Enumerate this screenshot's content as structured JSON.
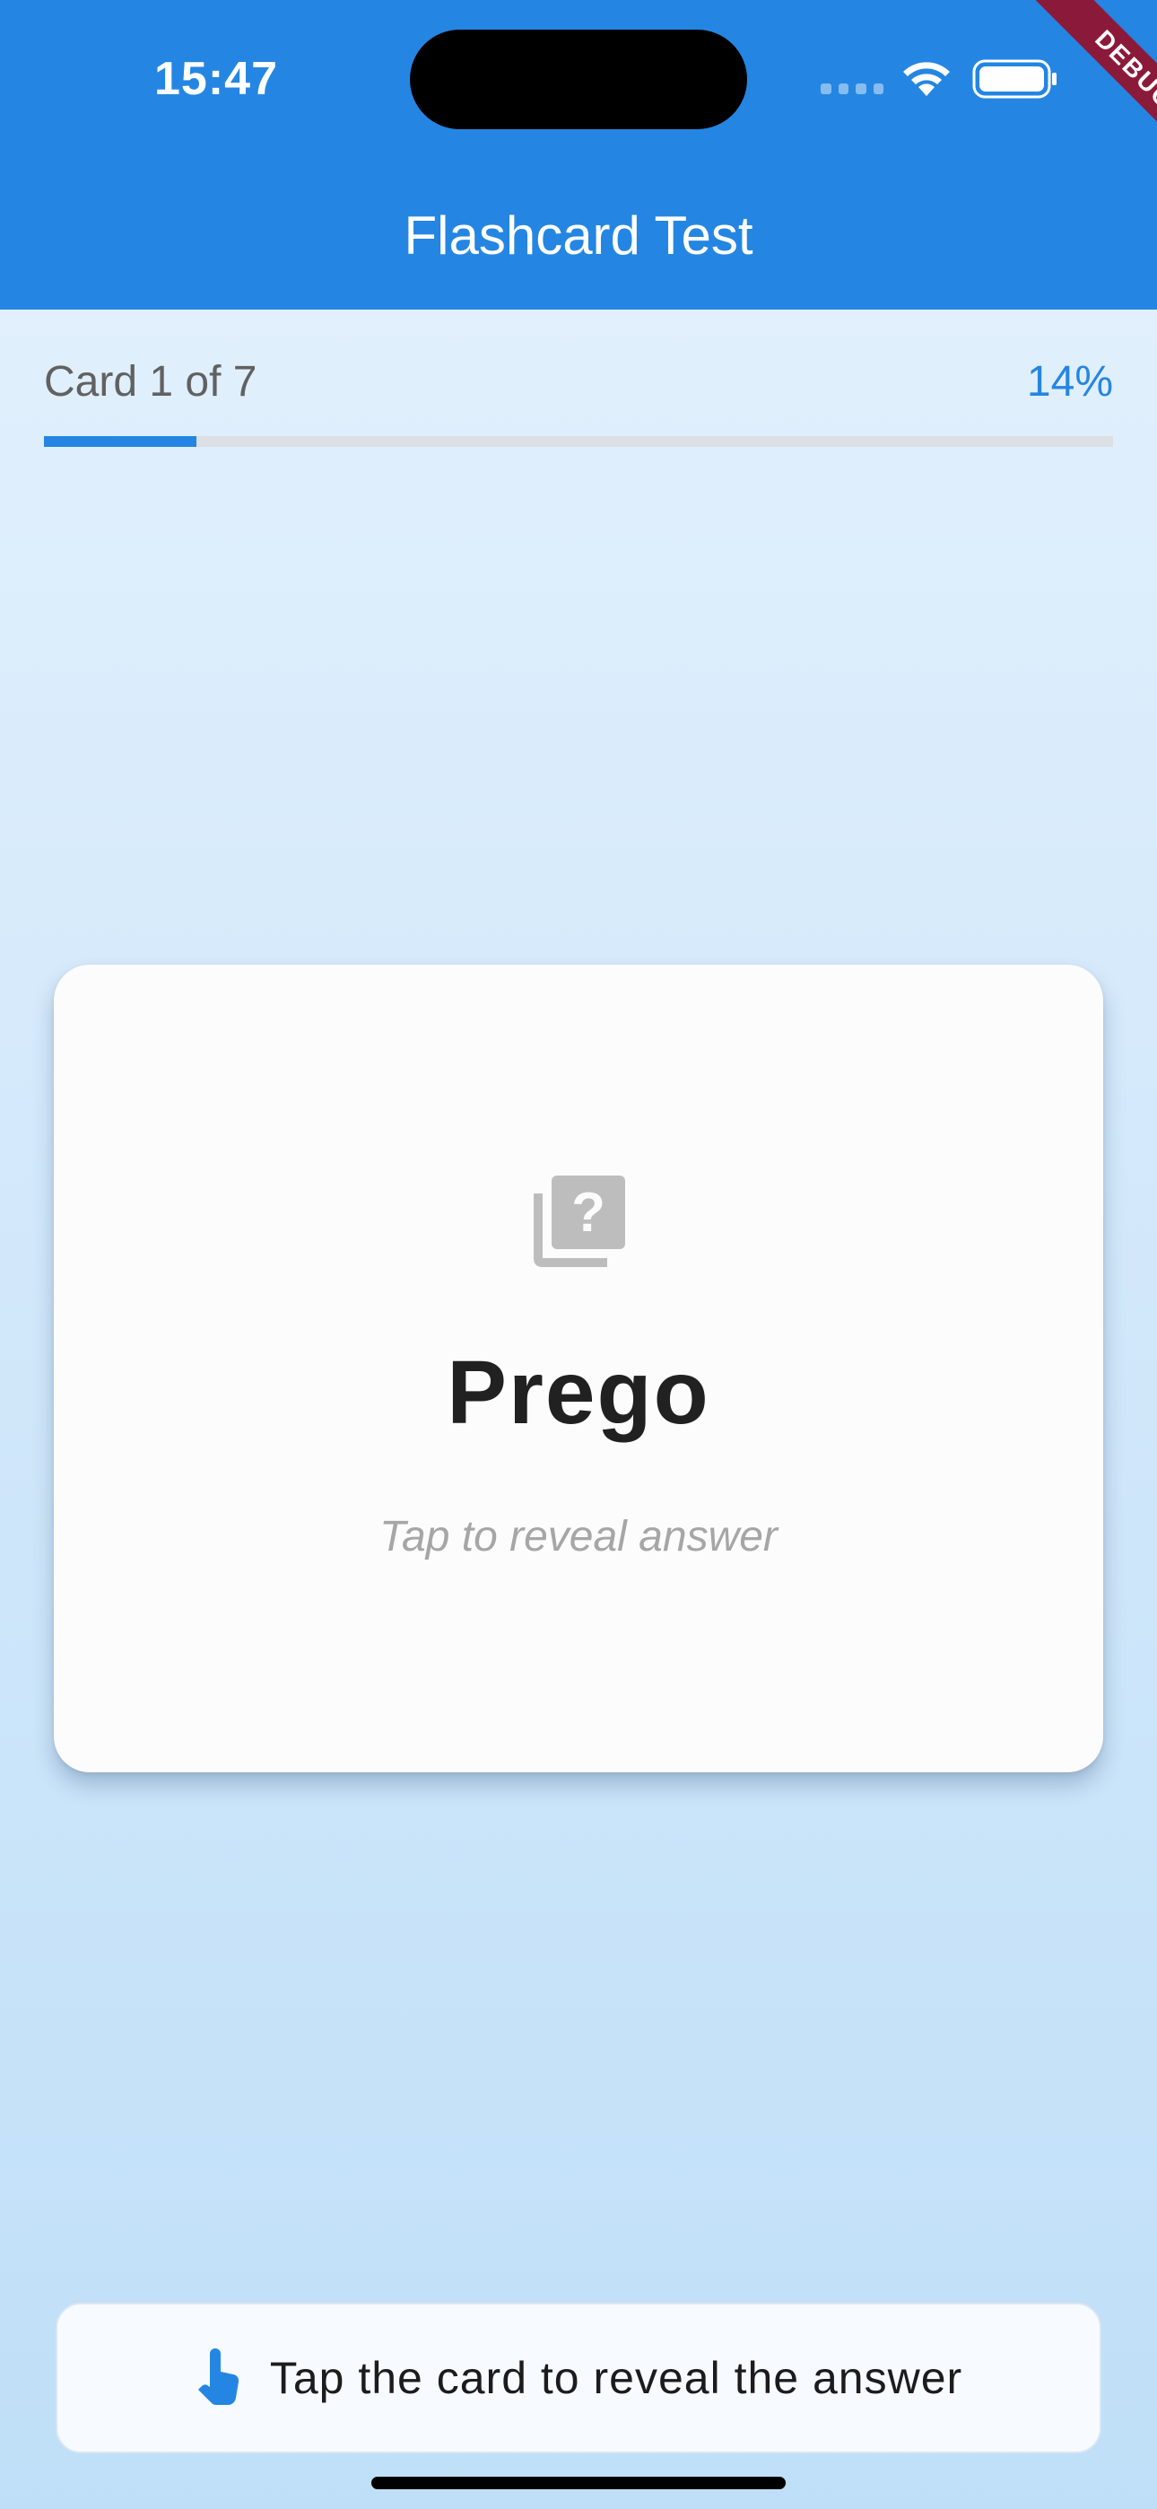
{
  "status_bar": {
    "time": "15:47",
    "debug_banner": "DEBUG"
  },
  "app_bar": {
    "title": "Flashcard Test"
  },
  "progress": {
    "label": "Card 1 of 7",
    "percent_text": "14%",
    "fraction": 0.143
  },
  "card": {
    "icon": "quiz-icon",
    "word": "Prego",
    "hint": "Tap to reveal answer"
  },
  "bottom_hint": {
    "icon": "touch-app-icon",
    "text": "Tap the card to reveal the answer"
  },
  "colors": {
    "primary": "#2486e2",
    "debug_ribbon": "#8b1a3a"
  }
}
